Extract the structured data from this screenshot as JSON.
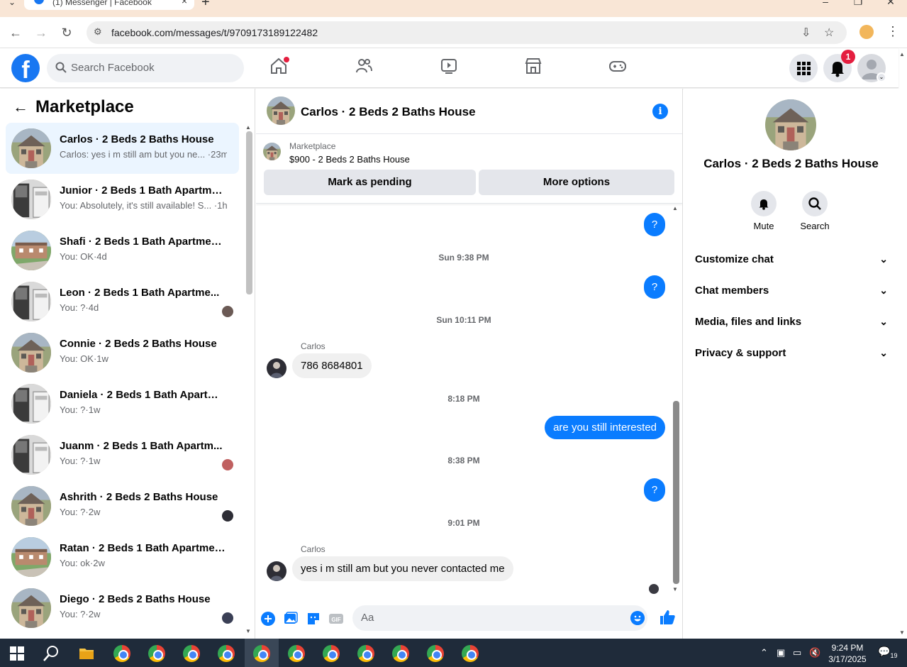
{
  "browser": {
    "tab_title": "(1) Messenger | Facebook",
    "url": "facebook.com/messages/t/9709173189122482"
  },
  "header": {
    "search_placeholder": "Search Facebook",
    "notification_count": "1"
  },
  "left_panel": {
    "title": "Marketplace",
    "conversations": [
      {
        "title": "Carlos · 2 Beds 2 Baths House",
        "subtitle": "Carlos: yes i m still am but you ne... ·23m",
        "selected": true
      },
      {
        "title": "Junior · 2 Beds 1 Bath Apartmen...",
        "subtitle": "You: Absolutely, it's still available! S... ·1h"
      },
      {
        "title": "Shafi · 2 Beds 1 Bath Apartment/...",
        "subtitle": "You: OK·4d"
      },
      {
        "title": "Leon · 2 Beds 1 Bath Apartme...",
        "subtitle": "You: ?·4d"
      },
      {
        "title": "Connie · 2 Beds 2 Baths House",
        "subtitle": "You: OK·1w"
      },
      {
        "title": "Daniela · 2 Beds 1 Bath Apartme...",
        "subtitle": "You: ?·1w"
      },
      {
        "title": "Juanm · 2 Beds 1 Bath Apartm...",
        "subtitle": "You: ?·1w"
      },
      {
        "title": "Ashrith · 2 Beds 2 Baths House",
        "subtitle": "You: ?·2w"
      },
      {
        "title": "Ratan · 2 Beds 1 Bath Apartment...",
        "subtitle": "You: ok·2w"
      },
      {
        "title": "Diego · 2 Beds 2 Baths House",
        "subtitle": "You: ?·2w"
      }
    ]
  },
  "chat": {
    "title": "Carlos · 2 Beds 2 Baths House",
    "marketplace_label": "Marketplace",
    "listing": "$900 - 2 Beds 2 Baths House",
    "mark_pending": "Mark as pending",
    "more_options": "More options",
    "messages": {
      "q1": "?",
      "ts1": "Sun 9:38 PM",
      "q2": "?",
      "ts2": "Sun 10:11 PM",
      "sender1": "Carlos",
      "in1": "786 8684801",
      "ts3": "8:18 PM",
      "out1": "are you still interested",
      "ts4": "8:38 PM",
      "q3": "?",
      "ts5": "9:01 PM",
      "sender2": "Carlos",
      "in2": "yes i m still am but you never contacted me"
    },
    "composer_placeholder": "Aa",
    "gif_label": "GIF"
  },
  "right_panel": {
    "name": "Carlos · 2 Beds 2 Baths House",
    "mute": "Mute",
    "search": "Search",
    "sections": [
      "Customize chat",
      "Chat members",
      "Media, files and links",
      "Privacy & support"
    ]
  },
  "taskbar": {
    "time": "9:24 PM",
    "date": "3/17/2025",
    "notifications": "19"
  },
  "colors": {
    "facebook_blue": "#1877f2",
    "messenger_blue": "#0a7cff",
    "selected_row": "#ebf5ff",
    "badge_red": "#e41e3f"
  }
}
